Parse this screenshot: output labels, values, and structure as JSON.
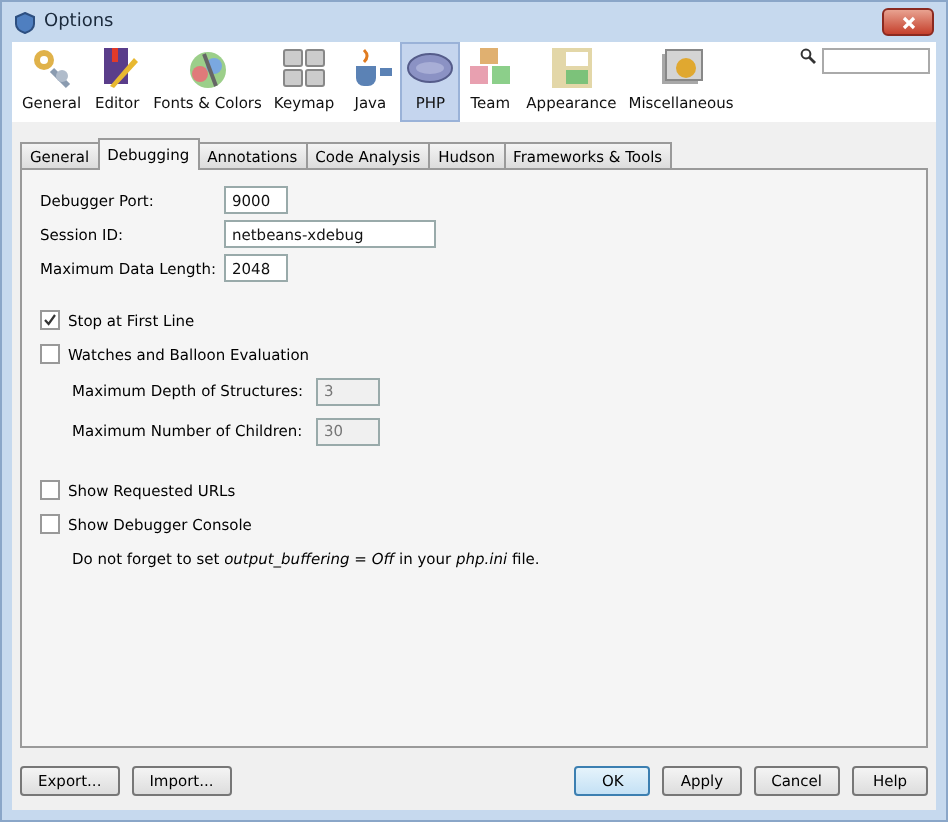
{
  "window": {
    "title": "Options"
  },
  "categories": [
    {
      "label": "General",
      "selected": false
    },
    {
      "label": "Editor",
      "selected": false
    },
    {
      "label": "Fonts & Colors",
      "selected": false
    },
    {
      "label": "Keymap",
      "selected": false
    },
    {
      "label": "Java",
      "selected": false
    },
    {
      "label": "PHP",
      "selected": true
    },
    {
      "label": "Team",
      "selected": false
    },
    {
      "label": "Appearance",
      "selected": false
    },
    {
      "label": "Miscellaneous",
      "selected": false
    }
  ],
  "tabs": [
    {
      "label": "General",
      "selected": false
    },
    {
      "label": "Debugging",
      "selected": true
    },
    {
      "label": "Annotations",
      "selected": false
    },
    {
      "label": "Code Analysis",
      "selected": false
    },
    {
      "label": "Hudson",
      "selected": false
    },
    {
      "label": "Frameworks & Tools",
      "selected": false
    }
  ],
  "fields": [
    {
      "label": "Debugger Port:",
      "value": "9000",
      "wide": false
    },
    {
      "label": "Session ID:",
      "value": "netbeans-xdebug",
      "wide": true
    },
    {
      "label": "Maximum Data Length:",
      "value": "2048",
      "wide": false
    }
  ],
  "options": [
    {
      "kind": "checkbox",
      "label": "Stop at First Line",
      "checked": true
    },
    {
      "kind": "checkbox",
      "label": "Watches and Balloon Evaluation",
      "checked": false
    },
    {
      "kind": "subfield",
      "label": "Maximum Depth of Structures:",
      "value": "3",
      "disabled": true
    },
    {
      "kind": "subfield",
      "label": "Maximum Number of Children:",
      "value": "30",
      "disabled": true
    },
    {
      "kind": "gap"
    },
    {
      "kind": "checkbox",
      "label": "Show Requested URLs",
      "checked": false
    },
    {
      "kind": "checkbox",
      "label": "Show Debugger Console",
      "checked": false
    },
    {
      "kind": "note",
      "text": "Do not forget to set *output_buffering = Off* in your *php.ini* file."
    }
  ],
  "left_buttons": [
    "Export...",
    "Import..."
  ],
  "right_buttons": [
    {
      "label": "OK",
      "default": true
    },
    {
      "label": "Apply",
      "default": false
    },
    {
      "label": "Cancel",
      "default": false
    },
    {
      "label": "Help",
      "default": false
    }
  ]
}
